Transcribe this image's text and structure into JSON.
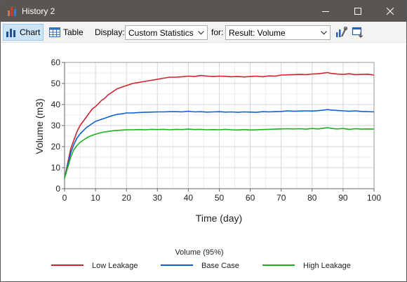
{
  "window": {
    "title": "History 2",
    "icons": {
      "app": "bar-chart-app-icon",
      "minimize": "minimize-icon",
      "maximize": "maximize-icon",
      "close": "close-icon"
    }
  },
  "toolbar": {
    "chart_label": "Chart",
    "table_label": "Table",
    "display_label": "Display:",
    "display_value": "Custom Statistics",
    "for_label": "for:",
    "for_value": "Result: Volume",
    "icons": [
      "chart-settings-icon",
      "export-icon"
    ]
  },
  "colors": {
    "titlebar": "#595551",
    "low_leakage": "#d0212e",
    "base_case": "#0d5fd6",
    "high_leakage": "#1cb01c",
    "active_tab": "#cce4f7"
  },
  "chart_data": {
    "type": "line",
    "xlabel": "Time (day)",
    "ylabel": "Volume (m3)",
    "xlim": [
      0,
      100
    ],
    "ylim": [
      0,
      60
    ],
    "xticks": [
      0,
      10,
      20,
      30,
      40,
      50,
      60,
      70,
      80,
      90,
      100
    ],
    "yticks": [
      0,
      10,
      20,
      30,
      40,
      50,
      60
    ],
    "grid": true,
    "legend_title": "Volume (95%)",
    "legend_position": "bottom",
    "x": [
      0,
      1,
      2,
      3,
      4,
      5,
      6,
      7,
      8,
      9,
      10,
      11,
      12,
      13,
      14,
      15,
      16,
      17,
      18,
      19,
      20,
      22,
      24,
      26,
      28,
      30,
      32,
      34,
      36,
      38,
      40,
      42,
      44,
      46,
      48,
      50,
      52,
      54,
      56,
      58,
      60,
      62,
      64,
      66,
      68,
      70,
      72,
      74,
      76,
      78,
      80,
      82,
      84,
      85,
      86,
      88,
      90,
      92,
      94,
      96,
      98,
      100
    ],
    "series": [
      {
        "name": "Low Leakage",
        "color": "#d0212e",
        "values": [
          5,
          12,
          19,
          23,
          27,
          30,
          32,
          34,
          36,
          38,
          39,
          40.5,
          42,
          43,
          44.5,
          45.5,
          46.5,
          47.5,
          48,
          48.5,
          49,
          50,
          50.5,
          51,
          51.5,
          52,
          52.5,
          53,
          53,
          53.2,
          53.5,
          53.3,
          53.8,
          53.5,
          53.3,
          53.5,
          53.4,
          53.2,
          53.3,
          53.1,
          53.3,
          53.5,
          53.2,
          53.6,
          53.5,
          54,
          54.1,
          54.2,
          54.3,
          54.2,
          54.5,
          54.6,
          55,
          55.2,
          54.8,
          54.5,
          54.3,
          54.6,
          54.2,
          54.3,
          54.4,
          54
        ]
      },
      {
        "name": "Base Case",
        "color": "#0d5fd6",
        "values": [
          5,
          11,
          17,
          21,
          24,
          26,
          27.5,
          29,
          30,
          31,
          32,
          32.5,
          33,
          33.5,
          34,
          34.5,
          35,
          35.3,
          35.5,
          35.7,
          36,
          36,
          36.2,
          36.3,
          36.4,
          36.5,
          36.5,
          36.6,
          36.6,
          36.5,
          36.8,
          36.5,
          36.6,
          36.4,
          36.5,
          36.6,
          36.4,
          36.5,
          36.3,
          36.5,
          36.4,
          36.3,
          36.6,
          36.5,
          36.6,
          36.7,
          37,
          36.8,
          36.9,
          37,
          36.9,
          37.1,
          37.4,
          37.6,
          37.4,
          37.2,
          37,
          36.8,
          37,
          36.7,
          36.6,
          36.5
        ]
      },
      {
        "name": "High Leakage",
        "color": "#1cb01c",
        "values": [
          5,
          10,
          15,
          18.5,
          20.5,
          22,
          23,
          24,
          24.8,
          25.4,
          25.9,
          26.3,
          26.7,
          27,
          27.2,
          27.4,
          27.6,
          27.7,
          27.8,
          27.9,
          28,
          28,
          28.1,
          28,
          28.2,
          28.1,
          28.2,
          28,
          28.2,
          28.1,
          28.3,
          28.1,
          28.2,
          28,
          28.1,
          28,
          28.2,
          28,
          27.9,
          28.1,
          27.9,
          28,
          28.1,
          28.2,
          28.3,
          28.4,
          28.5,
          28.4,
          28.5,
          28.3,
          28.6,
          28.4,
          28.8,
          29,
          28.7,
          28.4,
          28.6,
          28.2,
          28.5,
          28.3,
          28.4,
          28.3
        ]
      }
    ]
  }
}
